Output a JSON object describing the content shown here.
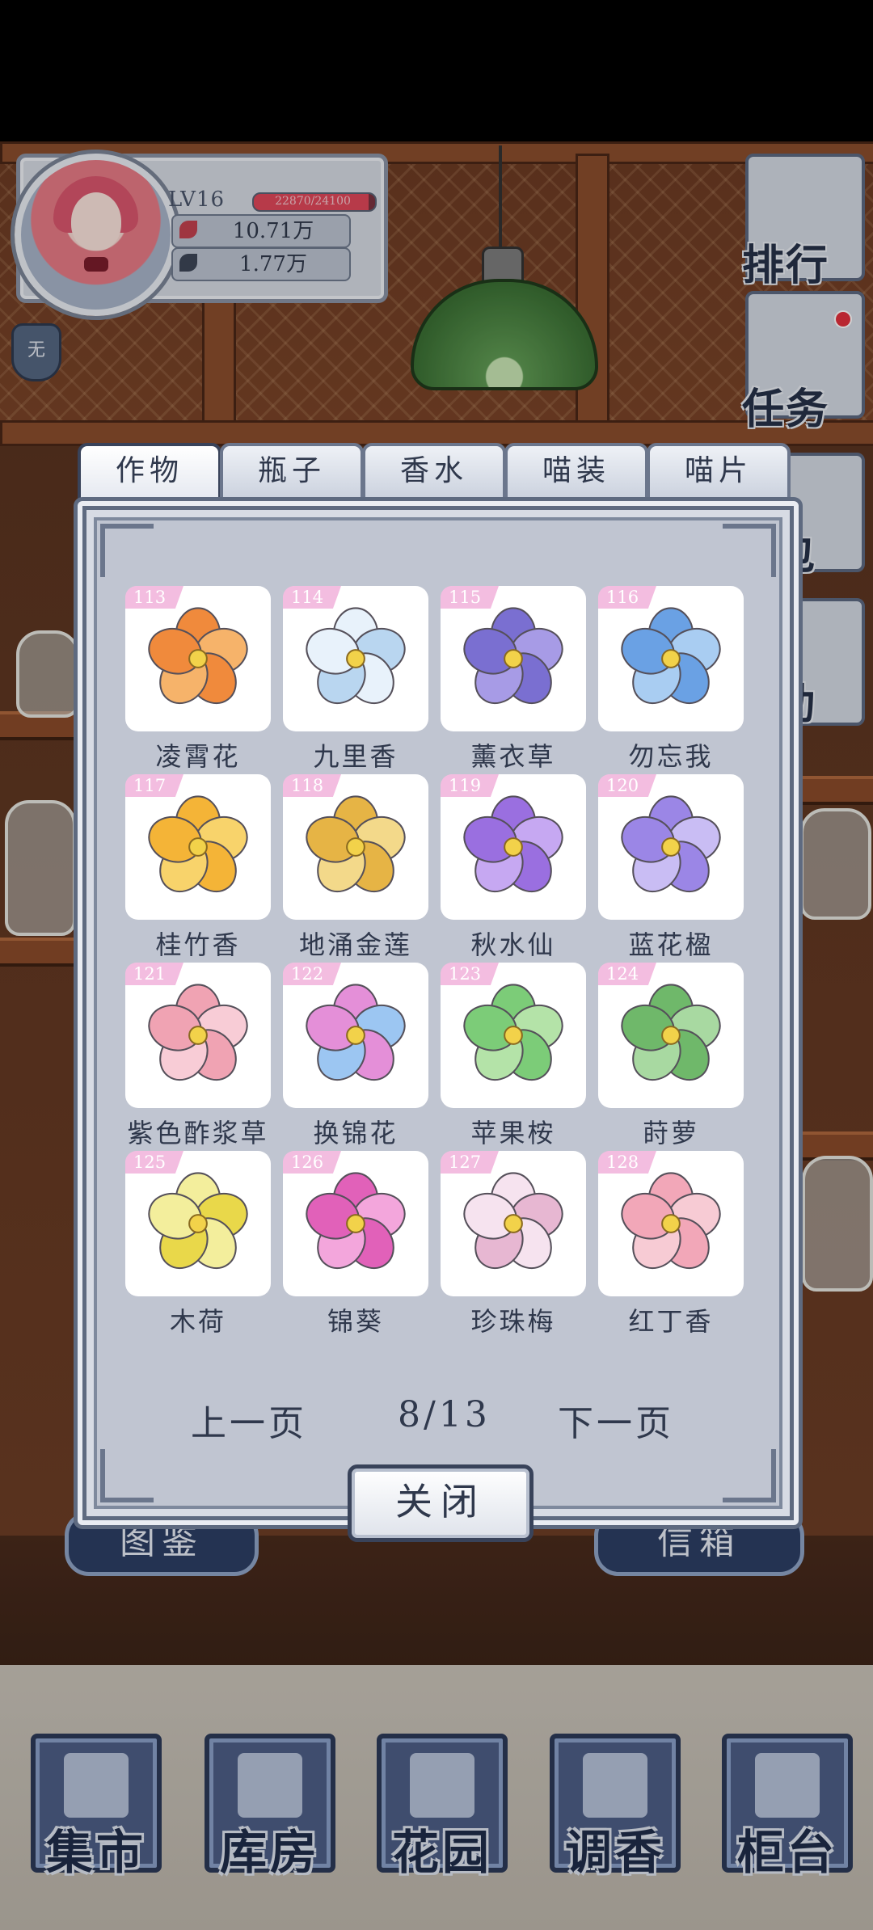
{
  "player": {
    "level": "LV16",
    "xp_text": "22870/24100",
    "xp_fraction": 0.949,
    "currency1": "10.71万",
    "currency2": "1.77万",
    "badge": "无"
  },
  "side_buttons": {
    "ranking": "排行",
    "tasks": "任务",
    "bag": "包",
    "events": "动"
  },
  "under_buttons": {
    "left": "图鉴",
    "right": "信箱"
  },
  "tabs": [
    "作物",
    "瓶子",
    "香水",
    "喵装",
    "喵片"
  ],
  "items": [
    {
      "num": "113",
      "name": "凌霄花",
      "colors": [
        "#f08a3c",
        "#f6b36a"
      ]
    },
    {
      "num": "114",
      "name": "九里香",
      "colors": [
        "#e8f2fb",
        "#b9d6f0"
      ]
    },
    {
      "num": "115",
      "name": "薰衣草",
      "colors": [
        "#7a6fd1",
        "#a79be6"
      ]
    },
    {
      "num": "116",
      "name": "勿忘我",
      "colors": [
        "#6aa1e4",
        "#a9cdf2"
      ]
    },
    {
      "num": "117",
      "name": "桂竹香",
      "colors": [
        "#f4b437",
        "#f8d36b"
      ]
    },
    {
      "num": "118",
      "name": "地涌金莲",
      "colors": [
        "#e6b445",
        "#f3d98a"
      ]
    },
    {
      "num": "119",
      "name": "秋水仙",
      "colors": [
        "#9a6fe0",
        "#c6a8f2"
      ]
    },
    {
      "num": "120",
      "name": "蓝花楹",
      "colors": [
        "#9b86e6",
        "#c9bdf4"
      ]
    },
    {
      "num": "121",
      "name": "紫色酢浆草",
      "colors": [
        "#f0a3b3",
        "#f8ccd6"
      ]
    },
    {
      "num": "122",
      "name": "换锦花",
      "colors": [
        "#e48fd8",
        "#9cc6f2"
      ]
    },
    {
      "num": "123",
      "name": "苹果桉",
      "colors": [
        "#7ccc78",
        "#b4e3a8"
      ]
    },
    {
      "num": "124",
      "name": "莳萝",
      "colors": [
        "#6fb86a",
        "#a8d9a1"
      ]
    },
    {
      "num": "125",
      "name": "木荷",
      "colors": [
        "#f3ee9c",
        "#e9d84a"
      ]
    },
    {
      "num": "126",
      "name": "锦葵",
      "colors": [
        "#e161b9",
        "#f3a6dc"
      ]
    },
    {
      "num": "127",
      "name": "珍珠梅",
      "colors": [
        "#f6e3ef",
        "#e7b7d2"
      ]
    },
    {
      "num": "128",
      "name": "红丁香",
      "colors": [
        "#f2a7b8",
        "#f7cbd4"
      ]
    }
  ],
  "pager": {
    "prev": "上一页",
    "page": "8/13",
    "next": "下一页"
  },
  "close_label": "关闭",
  "nav": [
    "集市",
    "库房",
    "花园",
    "调香",
    "柜台"
  ]
}
